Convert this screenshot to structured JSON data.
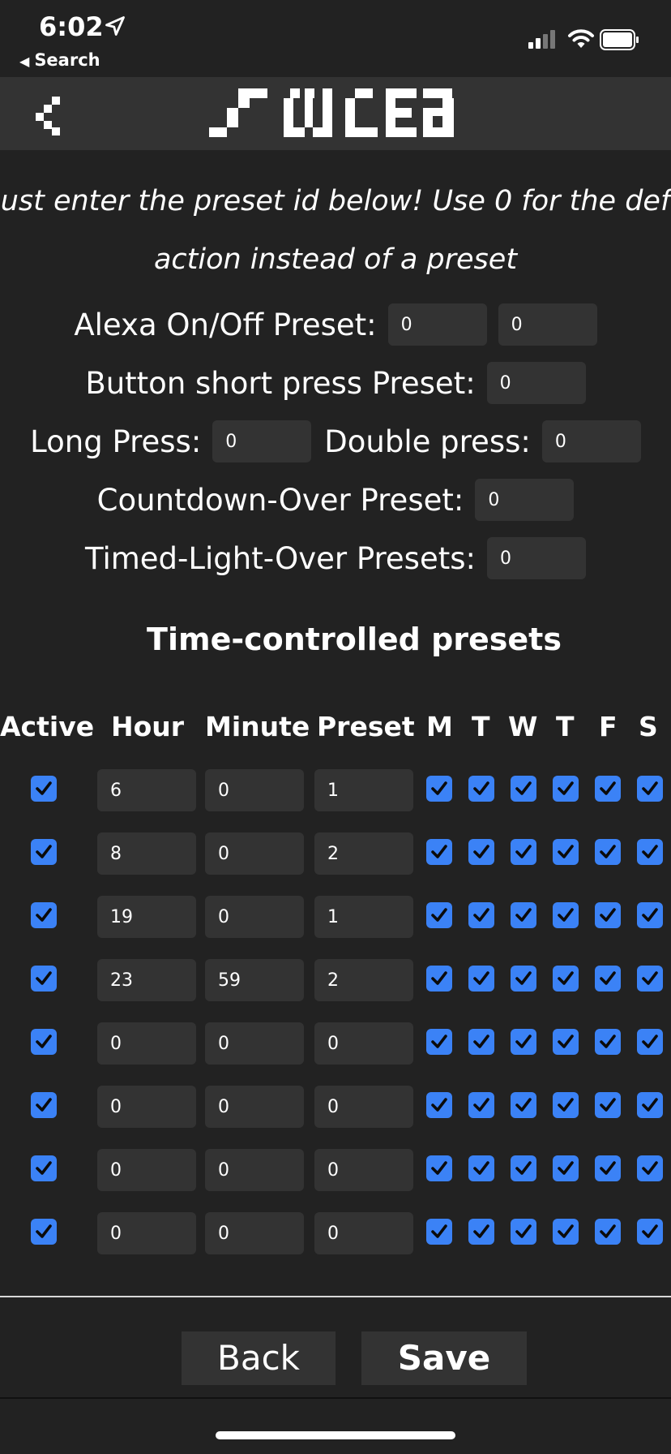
{
  "status_bar": {
    "time": "6:02",
    "back_app": "Search"
  },
  "header": {
    "logo_text": "WLED",
    "back_icon": "chevron-left-icon"
  },
  "instructions": {
    "line1": "ust enter the preset id below! Use 0 for the def",
    "line2": "action instead of a preset"
  },
  "presets": {
    "alexa_label": "Alexa On/Off Preset:",
    "alexa_on_value": "0",
    "alexa_off_value": "0",
    "short_press_label": "Button short press Preset:",
    "short_press_value": "0",
    "long_press_label": "Long Press:",
    "long_press_value": "0",
    "double_press_label": "Double press:",
    "double_press_value": "0",
    "countdown_label": "Countdown-Over Preset:",
    "countdown_value": "0",
    "timed_light_label": "Timed-Light-Over Presets:",
    "timed_light_value": "0"
  },
  "time_controlled": {
    "title": "Time-controlled presets",
    "headers": {
      "active": "Active",
      "hour": "Hour",
      "minute": "Minute",
      "preset": "Preset",
      "days": [
        "M",
        "T",
        "W",
        "T",
        "F",
        "S"
      ]
    },
    "rows": [
      {
        "hour": "6",
        "minute": "0",
        "preset": "1"
      },
      {
        "hour": "8",
        "minute": "0",
        "preset": "2"
      },
      {
        "hour": "19",
        "minute": "0",
        "preset": "1"
      },
      {
        "hour": "23",
        "minute": "59",
        "preset": "2"
      },
      {
        "hour": "0",
        "minute": "0",
        "preset": "0"
      },
      {
        "hour": "0",
        "minute": "0",
        "preset": "0"
      },
      {
        "hour": "0",
        "minute": "0",
        "preset": "0"
      },
      {
        "hour": "0",
        "minute": "0",
        "preset": "0"
      }
    ]
  },
  "footer": {
    "back_label": "Back",
    "save_label": "Save"
  },
  "colors": {
    "background": "#222222",
    "input_bg": "#333333",
    "checkbox": "#3b82f6"
  }
}
